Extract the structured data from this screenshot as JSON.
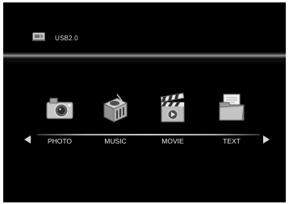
{
  "header": {
    "source_label": "USB2.0",
    "source_icon": "usb-drive-icon"
  },
  "menu": {
    "items": [
      {
        "label": "PHOTO",
        "icon": "camera-icon"
      },
      {
        "label": "MUSIC",
        "icon": "music-player-icon"
      },
      {
        "label": "MOVIE",
        "icon": "clapperboard-icon"
      },
      {
        "label": "TEXT",
        "icon": "folder-document-icon"
      }
    ],
    "left_arrow_icon": "arrow-left-icon",
    "right_arrow_icon": "arrow-right-icon"
  },
  "colors": {
    "background": "#000000",
    "text": "#e8e8e8",
    "divider": "#9a9a9a"
  }
}
